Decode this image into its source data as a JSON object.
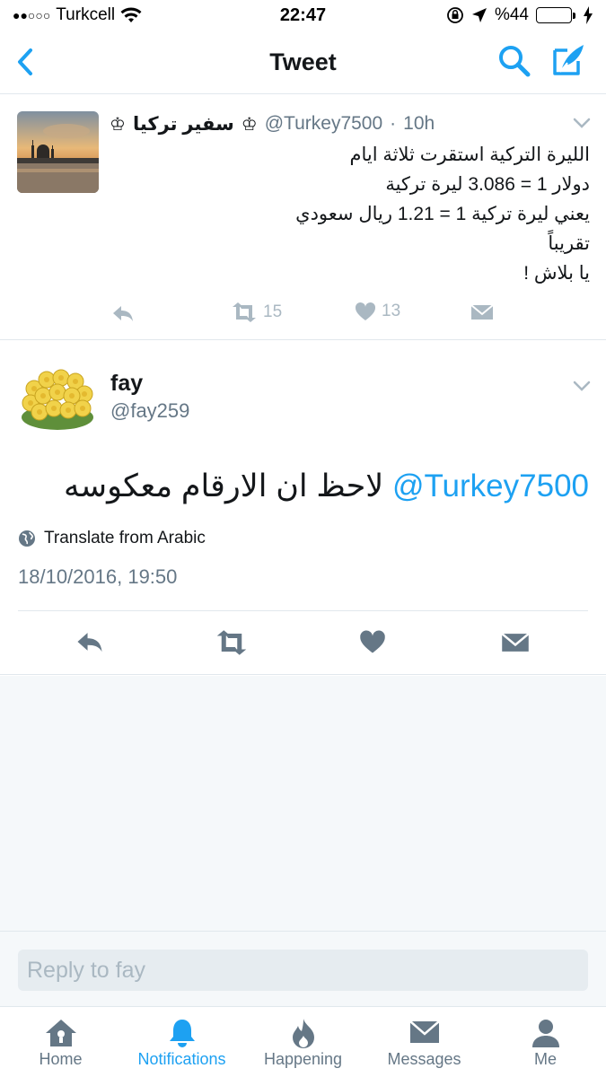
{
  "status_bar": {
    "signal_dots": "●●○○○",
    "carrier": "Turkcell",
    "time": "22:47",
    "battery_percent": "%44",
    "battery_level": 0.44
  },
  "nav": {
    "title": "Tweet"
  },
  "parent_tweet": {
    "name": "سفير تركيا",
    "crown_left": "♔",
    "crown_right": "♔",
    "handle": "@Turkey7500",
    "separator": "·",
    "time": "10h",
    "lines": [
      "الليرة التركية استقرت ثلاثة ايام",
      "دولار 1 = 3.086 ليرة تركية",
      "يعني ليرة تركية 1 = 1.21 ريال سعودي",
      "تقريباً",
      "يا بلاش !"
    ],
    "retweet_count": "15",
    "like_count": "13"
  },
  "focal_tweet": {
    "name": "fay",
    "handle": "@fay259",
    "mention": "@Turkey7500",
    "text": "لاحظ ان الارقام معكوسه",
    "translate_label": "Translate from Arabic",
    "timestamp": "18/10/2016, 19:50"
  },
  "reply": {
    "placeholder": "Reply to fay"
  },
  "tabs": [
    {
      "label": "Home",
      "icon": "home-icon",
      "active": false
    },
    {
      "label": "Notifications",
      "icon": "bell-icon",
      "active": true
    },
    {
      "label": "Happening",
      "icon": "flame-icon",
      "active": false
    },
    {
      "label": "Messages",
      "icon": "envelope-icon",
      "active": false
    },
    {
      "label": "Me",
      "icon": "person-icon",
      "active": false
    }
  ],
  "colors": {
    "accent": "#1da1f2",
    "text": "#14171a",
    "secondary": "#657786",
    "icon_gray": "#aab8c2",
    "battery_green": "#4cd964"
  }
}
